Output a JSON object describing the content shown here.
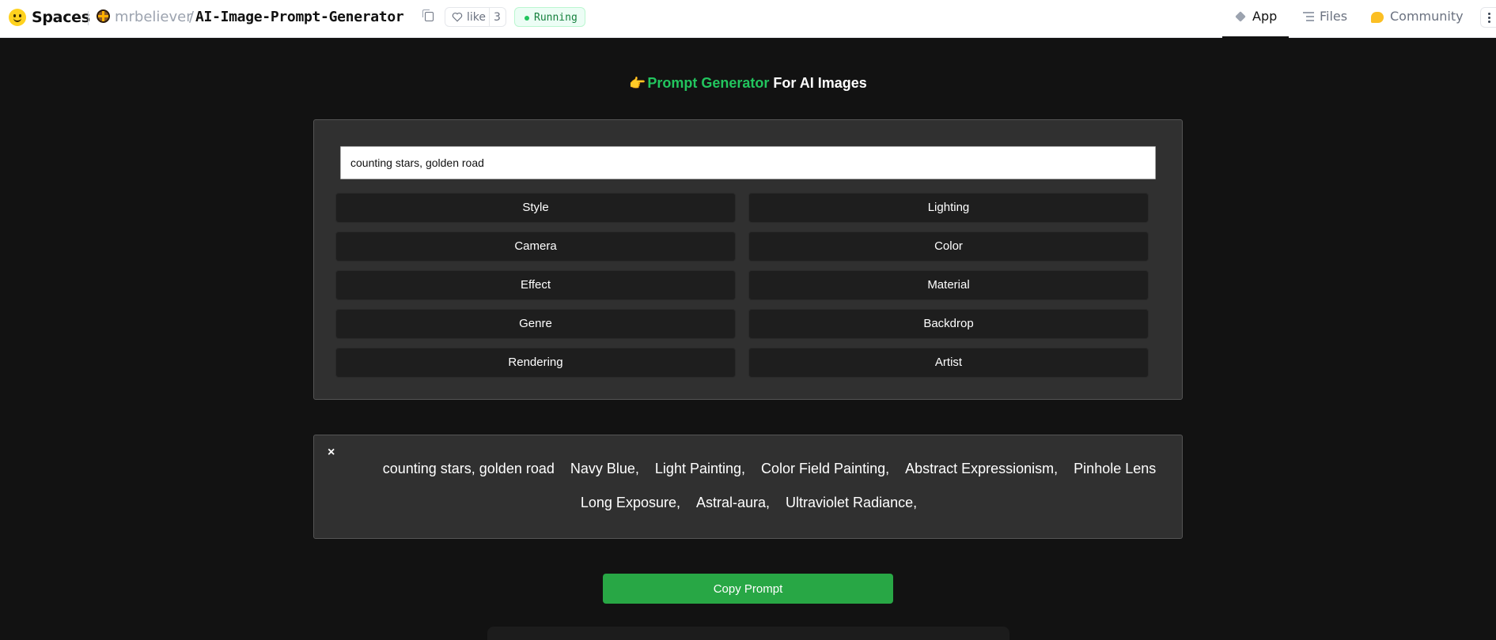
{
  "header": {
    "brand": "Spaces",
    "owner": "mrbeliever",
    "separator": "/",
    "repo": "AI-Image-Prompt-Generator",
    "like_label": "like",
    "like_count": "3",
    "status": "Running",
    "tabs": [
      {
        "label": "App",
        "icon": "cube-icon"
      },
      {
        "label": "Files",
        "icon": "files-icon"
      },
      {
        "label": "Community",
        "icon": "community-icon"
      }
    ]
  },
  "app": {
    "title_pointer": "👉",
    "title_green": "Prompt Generator",
    "title_rest": " For AI Images",
    "input_value": "counting stars, golden road",
    "categories": [
      "Style",
      "Lighting",
      "Camera",
      "Color",
      "Effect",
      "Material",
      "Genre",
      "Backdrop",
      "Rendering",
      "Artist"
    ],
    "result_close": "×",
    "result_line1": [
      "counting stars, golden road",
      "Navy Blue,",
      "Light Painting,",
      "Color Field Painting,",
      "Abstract Expressionism,",
      "Pinhole Lens"
    ],
    "result_line2": [
      "Long Exposure,",
      "Astral-aura,",
      "Ultraviolet Radiance,"
    ],
    "copy_button": "Copy Prompt"
  },
  "colors": {
    "background": "#121212",
    "panel": "#303030",
    "accent_green": "#22c55e",
    "button_green": "#28a745"
  }
}
